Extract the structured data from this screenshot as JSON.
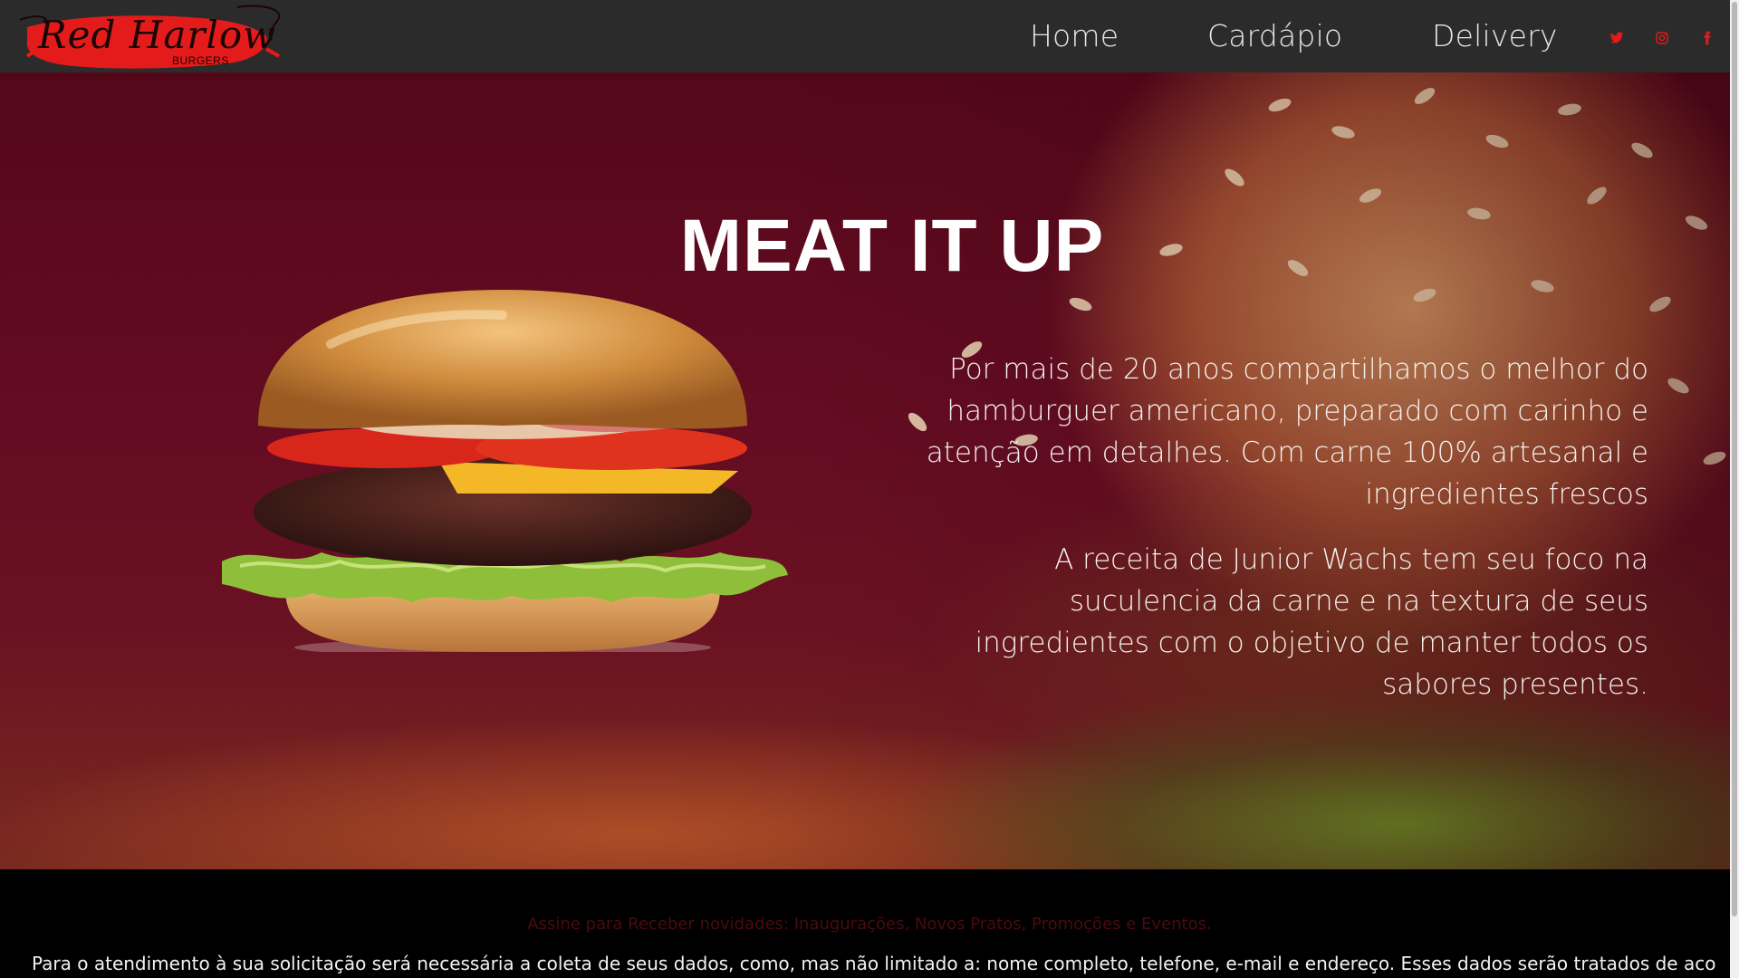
{
  "brand": {
    "name": "Red Harlow",
    "subtitle": "BURGERS",
    "accent_color": "#e41b1b"
  },
  "nav": {
    "items": [
      {
        "label": "Home"
      },
      {
        "label": "Cardápio"
      },
      {
        "label": "Delivery"
      }
    ],
    "social": [
      {
        "icon": "twitter-icon",
        "color": "#e41b1b"
      },
      {
        "icon": "instagram-icon",
        "color": "#e41b1b"
      },
      {
        "icon": "facebook-icon",
        "color": "#e41b1b"
      }
    ]
  },
  "hero": {
    "title": "MEAT IT UP",
    "paragraph_1": "Por mais de 20 anos compartilhamos o melhor do hamburguer americano, preparado com carinho e atenção em detalhes. Com carne 100% artesanal e ingredientes frescos",
    "paragraph_2": "A receita de Junior Wachs tem seu foco na suculencia da carne e na textura de seus ingredientes com o objetivo de manter todos os sabores presentes."
  },
  "footer": {
    "newsletter": "Assine para Receber novidades: Inaugurações, Novos Pratos, Promoções e Eventos.",
    "privacy": "Para o atendimento à sua solicitação será necessária a coleta de seus dados, como, mas não limitado a: nome completo, telefone, e-mail e endereço. Esses dados serão tratados de acordo com a Política de"
  }
}
